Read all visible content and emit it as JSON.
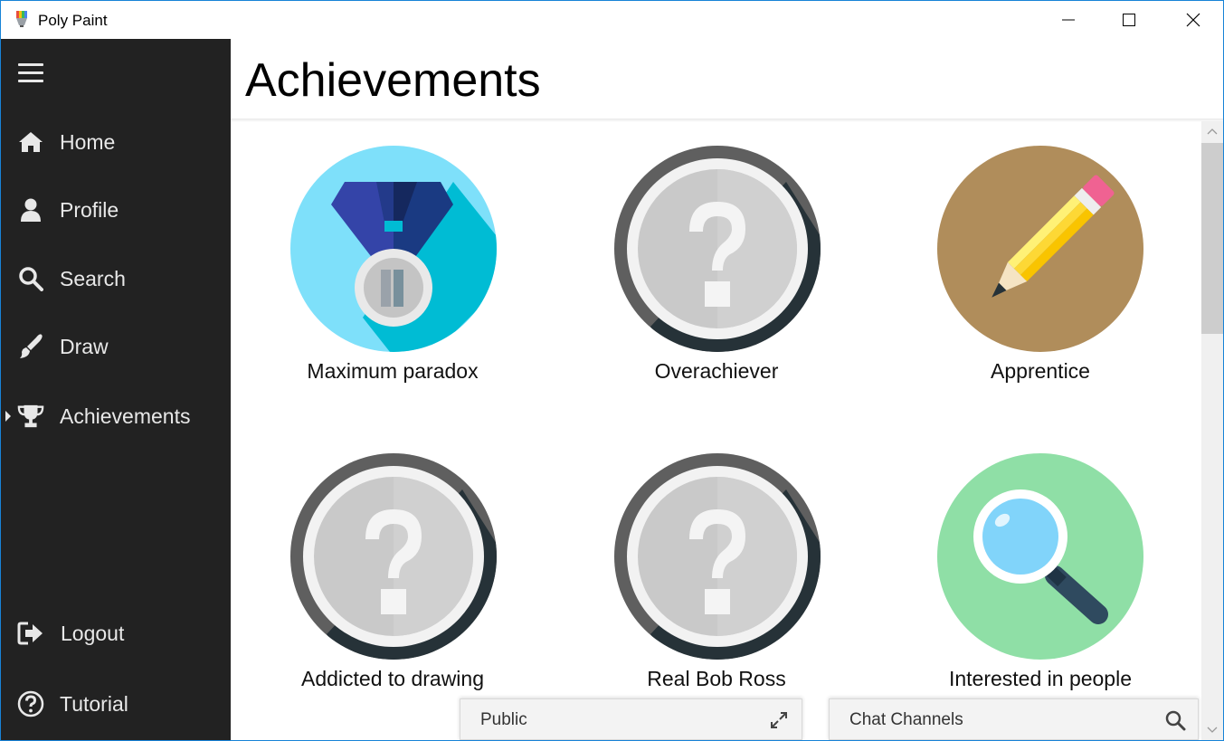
{
  "window": {
    "title": "Poly Paint"
  },
  "sidebar": {
    "items": [
      {
        "label": "Home",
        "icon": "home-icon"
      },
      {
        "label": "Profile",
        "icon": "user-icon"
      },
      {
        "label": "Search",
        "icon": "search-icon"
      },
      {
        "label": "Draw",
        "icon": "brush-icon"
      },
      {
        "label": "Achievements",
        "icon": "trophy-icon",
        "selected": true
      }
    ],
    "bottom_items": [
      {
        "label": "Logout",
        "icon": "logout-icon"
      },
      {
        "label": "Tutorial",
        "icon": "help-icon"
      }
    ]
  },
  "header": {
    "title": "Achievements"
  },
  "achievements": [
    {
      "name": "Maximum paradox",
      "icon": "medal-icon",
      "unlocked": true
    },
    {
      "name": "Overachiever",
      "icon": "question-icon",
      "unlocked": false
    },
    {
      "name": "Apprentice",
      "icon": "pencil-icon",
      "unlocked": true
    },
    {
      "name": "Addicted to drawing",
      "icon": "question-icon",
      "unlocked": false
    },
    {
      "name": "Real Bob Ross",
      "icon": "question-icon",
      "unlocked": false
    },
    {
      "name": "Interested in people",
      "icon": "magnifier-icon",
      "unlocked": true
    }
  ],
  "chat": {
    "public_label": "Public",
    "channels_label": "Chat Channels"
  },
  "colors": {
    "sidebar_bg": "#222222",
    "window_border": "#1883d7",
    "medal_bg": "#7ee0fa",
    "pencil_bg": "#b08d5b",
    "magnifier_bg": "#8fdfa6",
    "locked_ring": "#5f5f5f"
  }
}
